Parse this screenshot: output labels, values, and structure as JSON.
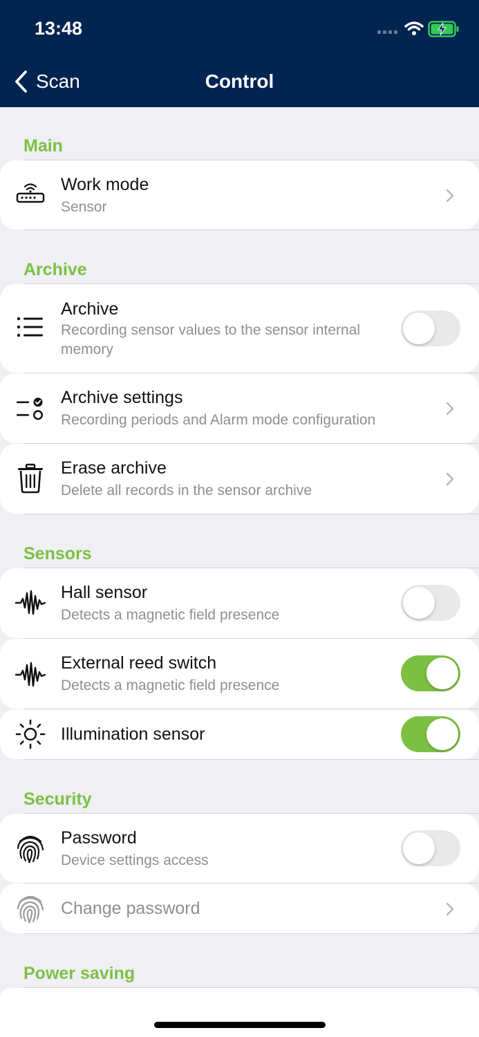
{
  "status_bar": {
    "time": "13:48"
  },
  "nav": {
    "back_label": "Scan",
    "title": "Control"
  },
  "colors": {
    "header": "#012451",
    "accent": "#7cc043"
  },
  "sections": {
    "main": {
      "title": "Main",
      "work_mode": {
        "title": "Work mode",
        "subtitle": "Sensor",
        "icon": "router-icon"
      }
    },
    "archive": {
      "title": "Archive",
      "archive": {
        "title": "Archive",
        "subtitle": "Recording sensor values to the sensor internal memory",
        "toggle_on": false,
        "icon": "list-icon"
      },
      "archive_settings": {
        "title": "Archive settings",
        "subtitle": "Recording periods and Alarm mode configuration",
        "icon": "settings-toggle-icon"
      },
      "erase_archive": {
        "title": "Erase archive",
        "subtitle": "Delete all records in the sensor archive",
        "icon": "trash-icon"
      }
    },
    "sensors": {
      "title": "Sensors",
      "hall_sensor": {
        "title": "Hall sensor",
        "subtitle": "Detects a magnetic field presence",
        "toggle_on": false,
        "icon": "waveform-icon"
      },
      "external_reed": {
        "title": "External reed switch",
        "subtitle": "Detects a magnetic field presence",
        "toggle_on": true,
        "icon": "waveform-icon"
      },
      "illumination": {
        "title": "Illumination sensor",
        "toggle_on": true,
        "icon": "sun-icon"
      }
    },
    "security": {
      "title": "Security",
      "password": {
        "title": "Password",
        "subtitle": "Device settings access",
        "toggle_on": false,
        "icon": "fingerprint-icon"
      },
      "change_password": {
        "title": "Change password",
        "enabled": false,
        "icon": "fingerprint-icon"
      }
    },
    "power_saving": {
      "title": "Power saving"
    }
  }
}
